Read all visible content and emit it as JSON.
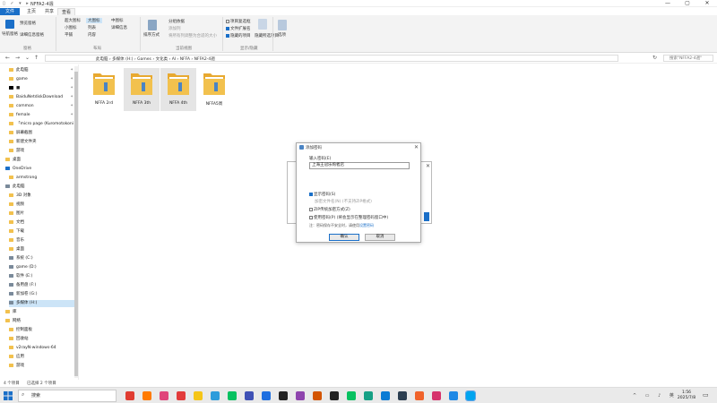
{
  "window": {
    "title": "NFFA2-4週",
    "quick_access": "▯ ✓ ▾ ▸",
    "min": "—",
    "max": "▢",
    "close": "✕"
  },
  "tabs": [
    "文件",
    "主页",
    "共享",
    "查看"
  ],
  "ribbon": {
    "nav_pane": "导航窗格",
    "preview_pane": "预览窗格",
    "details_pane": "详细信息窗格",
    "layout_items": [
      "超大图标",
      "大图标",
      "中图标",
      "小图标",
      "列表",
      "详细信息",
      "平铺",
      "内容"
    ],
    "sort_by": "排序方式",
    "group_by": "分组依据",
    "add_columns": "添加列",
    "fit_columns": "将所有列调整为合适的大小",
    "item_checkboxes": "项目复选框",
    "file_extensions": "文件扩展名",
    "hidden_items": "隐藏的项目",
    "hide_selected": "隐藏所选项目",
    "options": "选项",
    "groups": [
      "窗格",
      "布局",
      "当前视图",
      "显示/隐藏"
    ]
  },
  "address": {
    "back": "←",
    "forward": "→",
    "up_history": "⌄",
    "up": "↑",
    "crumbs": "此电脑 › 多媒体 (H:) › Games › 文化类 › AI › NFFA › NFFA2-4週",
    "refresh": "↻",
    "search_placeholder": "搜索\"NFFA2-4週\""
  },
  "nav_items": [
    {
      "label": "此电脑",
      "pin": true,
      "sel": false
    },
    {
      "label": "game",
      "pin": true,
      "sel": false
    },
    {
      "label": "■",
      "pin": true,
      "sel": false
    },
    {
      "label": "BaiduNetdiskDownload",
      "pin": true,
      "sel": false
    },
    {
      "label": "common",
      "pin": true,
      "sel": false
    },
    {
      "label": "female",
      "pin": true,
      "sel": false
    },
    {
      "label": "「micro page (Kuromotokoni",
      "pin": false,
      "sel": false
    },
    {
      "label": "屏幕截图",
      "pin": false,
      "sel": false
    },
    {
      "label": "新建文件夹",
      "pin": false,
      "sel": false
    },
    {
      "label": "游戏",
      "pin": false,
      "sel": false
    },
    {
      "label": "桌面",
      "pin": false,
      "sel": false
    },
    {
      "label": "OneDrive",
      "pin": false,
      "sel": false
    },
    {
      "label": "armstrong",
      "pin": false,
      "sel": false
    },
    {
      "label": "此电脑",
      "pin": false,
      "sel": false
    },
    {
      "label": "3D 对象",
      "pin": false,
      "sel": false
    },
    {
      "label": "视频",
      "pin": false,
      "sel": false
    },
    {
      "label": "图片",
      "pin": false,
      "sel": false
    },
    {
      "label": "文档",
      "pin": false,
      "sel": false
    },
    {
      "label": "下载",
      "pin": false,
      "sel": false
    },
    {
      "label": "音乐",
      "pin": false,
      "sel": false
    },
    {
      "label": "桌面",
      "pin": false,
      "sel": false
    },
    {
      "label": "系统 (C:)",
      "pin": false,
      "sel": false
    },
    {
      "label": "game (D:)",
      "pin": false,
      "sel": false
    },
    {
      "label": "软件 (E:)",
      "pin": false,
      "sel": false
    },
    {
      "label": "备用盘 (F:)",
      "pin": false,
      "sel": false
    },
    {
      "label": "新加卷 (G:)",
      "pin": false,
      "sel": false
    },
    {
      "label": "多媒体 (H:)",
      "pin": false,
      "sel": true
    },
    {
      "label": "库",
      "pin": false,
      "sel": false
    },
    {
      "label": "网络",
      "pin": false,
      "sel": false
    },
    {
      "label": "控制面板",
      "pin": false,
      "sel": false
    },
    {
      "label": "回收站",
      "pin": false,
      "sel": false
    },
    {
      "label": "v2rayN-windows-64",
      "pin": false,
      "sel": false
    },
    {
      "label": "应用",
      "pin": false,
      "sel": false
    },
    {
      "label": "游戏",
      "pin": false,
      "sel": false
    }
  ],
  "folders": [
    {
      "label": "NFFA 2rd",
      "sel": false
    },
    {
      "label": "NFFA 3th",
      "sel": true
    },
    {
      "label": "NFFA 4th",
      "sel": true
    },
    {
      "label": "NFFA5周",
      "sel": false
    }
  ],
  "status": {
    "count": "4 个项目",
    "selected": "已选择 2 个项目"
  },
  "dialog": {
    "title": "添加密码",
    "prompt": "输入密码(E)",
    "value": "上海王冠乐购者店",
    "show_password": "显示密码(S)",
    "remember": "加密文件名(N) (不支持ZIP格式)",
    "zip_legacy": "ZIP传统加密方式(Z)",
    "use_manager": "使用密码(P) (将会显示在整理密码窗口中)",
    "hint_prefix": "注：密码保存不安全时，请使用",
    "hint_link": "设置密码",
    "ok": "确认",
    "cancel": "取消"
  },
  "taskbar": {
    "search": "搜索",
    "time": "1:56",
    "date": "2025/7/8"
  },
  "colors": {
    "accent": "#1a6fc8",
    "folder": "#f2c14e",
    "selected": "#cce4f7"
  }
}
